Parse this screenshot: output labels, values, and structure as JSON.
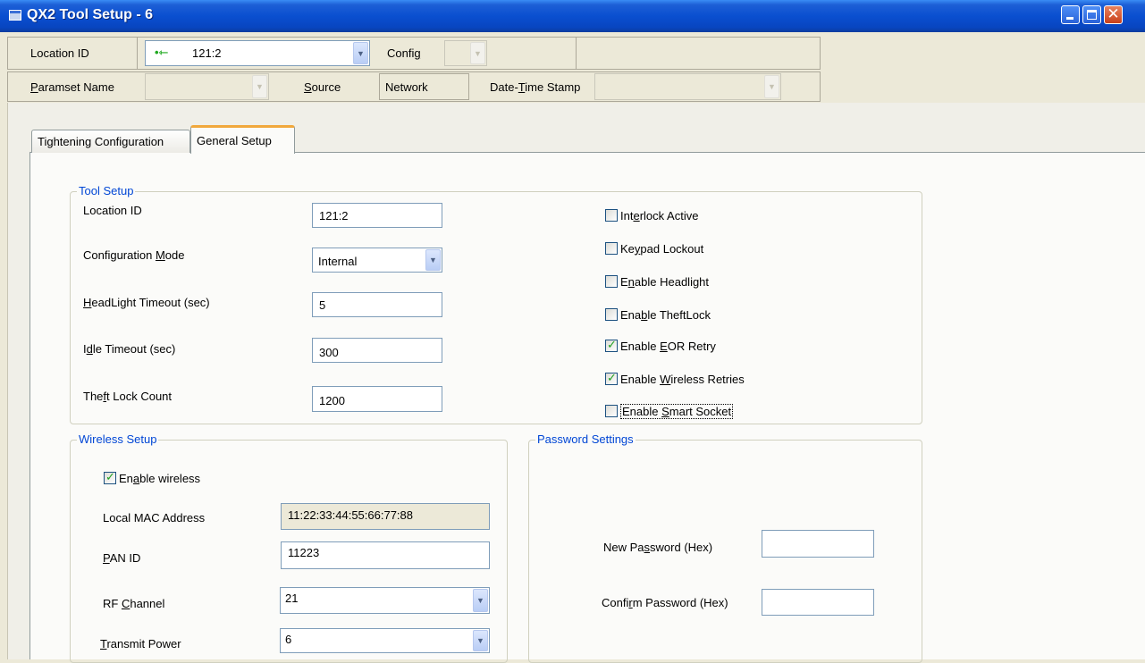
{
  "window": {
    "title": "QX2 Tool Setup - 6"
  },
  "toolbar1": {
    "location_label": "Location ID",
    "location_value": "121:2",
    "config_label_pre": "Confi",
    "config_label_u": "g",
    "config_value": ""
  },
  "toolbar2": {
    "paramset_label_u": "P",
    "paramset_label_rest": "aramset Name",
    "paramset_value": "",
    "source_label_u": "S",
    "source_label_rest": "ource",
    "source_value": "Network",
    "datetime_pre": "Date-",
    "datetime_u": "T",
    "datetime_rest": "ime Stamp",
    "datetime_value": ""
  },
  "tabs": {
    "tightening": "Tightening Configuration",
    "general": "General Setup"
  },
  "tool_setup": {
    "title": "Tool Setup",
    "location_id_label": "Location ID",
    "location_id_value": "121:2",
    "config_mode_pre": "Configuration ",
    "config_mode_u": "M",
    "config_mode_rest": "ode",
    "config_mode_value": "Internal",
    "headlight_u": "H",
    "headlight_rest": "eadLight Timeout (sec)",
    "headlight_value": "5",
    "idle_pre": "I",
    "idle_u": "d",
    "idle_rest": "le Timeout (sec)",
    "idle_value": "300",
    "theft_pre": "The",
    "theft_u": "f",
    "theft_rest": "t Lock Count",
    "theft_value": "1200"
  },
  "checkboxes": [
    {
      "pre": "Int",
      "u": "e",
      "rest": "rlock Active",
      "checked": false
    },
    {
      "pre": "Ke",
      "u": "y",
      "rest": "pad Lockout",
      "checked": false
    },
    {
      "pre": "E",
      "u": "n",
      "rest": "able Headlight",
      "checked": false
    },
    {
      "pre": "Ena",
      "u": "b",
      "rest": "le TheftLock",
      "checked": false
    },
    {
      "pre": "Enable ",
      "u": "E",
      "rest": "OR Retry",
      "checked": true
    },
    {
      "pre": "Enable ",
      "u": "W",
      "rest": "ireless Retries",
      "checked": true
    },
    {
      "pre": "Enable ",
      "u": "S",
      "rest": "mart Socket",
      "checked": false
    }
  ],
  "wireless": {
    "title": "Wireless Setup",
    "enable_pre": "En",
    "enable_u": "a",
    "enable_rest": "ble wireless",
    "enable_checked": true,
    "mac_label": "Local MAC Address",
    "mac_value": "11:22:33:44:55:66:77:88",
    "pan_u": "P",
    "pan_rest": "AN ID",
    "pan_value": "11223",
    "rf_pre": "RF ",
    "rf_u": "C",
    "rf_rest": "hannel",
    "rf_value": "21",
    "tx_u": "T",
    "tx_rest": "ransmit Power",
    "tx_value": "6"
  },
  "password": {
    "title": "Password Settings",
    "new_pre": "New Pa",
    "new_u": "s",
    "new_rest": "sword (Hex)",
    "new_value": "",
    "confirm_pre": "Confi",
    "confirm_u": "r",
    "confirm_rest": "m Password (Hex)",
    "confirm_value": ""
  }
}
